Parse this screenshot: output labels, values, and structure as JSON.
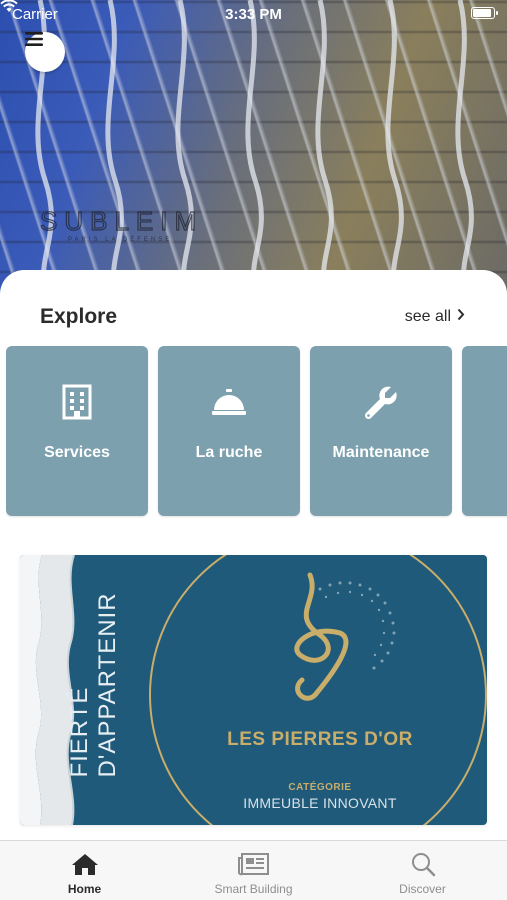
{
  "status_bar": {
    "carrier": "Carrier",
    "time": "3:33 PM"
  },
  "hero": {
    "logo_text": "SUBLEIM",
    "logo_sub": "PARIS LA DÉFENSE"
  },
  "explore": {
    "title": "Explore",
    "see_all": "see all",
    "tiles": [
      {
        "label": "Services",
        "icon": "building-icon"
      },
      {
        "label": "La ruche",
        "icon": "bell-icon"
      },
      {
        "label": "Maintenance",
        "icon": "wrench-icon"
      }
    ]
  },
  "banner": {
    "vertical_line1": "FIERTÉ",
    "vertical_line2": "D'APPARTENIR",
    "title": "LES PIERRES D'OR",
    "category_label": "CATÉGORIE",
    "category_value": "IMMEUBLE INNOVANT"
  },
  "tabbar": {
    "tabs": [
      {
        "label": "Home",
        "icon": "home-icon",
        "active": true
      },
      {
        "label": "Smart Building",
        "icon": "newspaper-icon",
        "active": false
      },
      {
        "label": "Discover",
        "icon": "search-icon",
        "active": false
      }
    ]
  },
  "colors": {
    "tile": "#7da0ae",
    "banner_blue": "#1f5a7a",
    "gold": "#c9ad6a"
  }
}
